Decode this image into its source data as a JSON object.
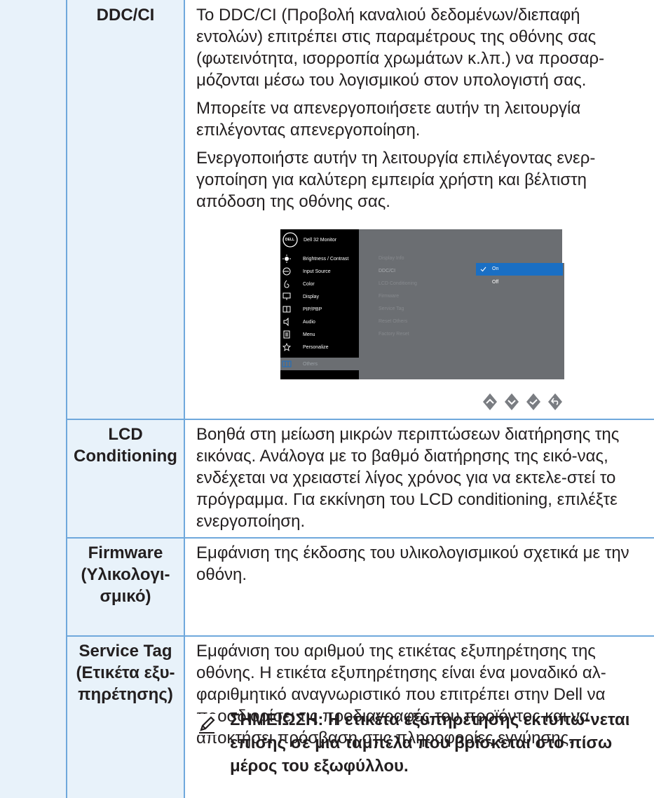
{
  "rows": [
    {
      "label": "DDC/CI",
      "paragraphs": [
        "Το DDC/CI (Προβολή καναλιού δεδομένων/διεπαφή εντολών) επιτρέπει στις παραμέτρους της οθόνης σας (φωτεινότητα, ισορροπία χρωμάτων κ.λπ.) να προσαρ-μόζονται μέσω του λογισμικού στον υπολογιστή σας.",
        "Μπορείτε να απενεργοποιήσετε αυτήν τη λειτουργία επιλέγοντας απενεργοποίηση.",
        "Ενεργοποιήστε αυτήν τη λειτουργία επιλέγοντας ενερ-γοποίηση για καλύτερη εμπειρία χρήστη και βέλτιστη απόδοση της οθόνης σας."
      ]
    },
    {
      "label_line1": "LCD",
      "label_line2": "Conditioning",
      "text": "Βοηθά στη μείωση μικρών περιπτώσεων διατήρησης της εικόνας. Ανάλογα με το βαθμό διατήρησης της εικό-νας, ενδέχεται να χρειαστεί λίγος χρόνος για να εκτελε-στεί το πρόγραμμα. Για εκκίνηση του LCD conditioning, επιλέξτε ενεργοποίηση."
    },
    {
      "label_line1": "Firmware",
      "label_line2": "(Υλικολογι-",
      "label_line3": "σμικό)",
      "text": "Εμφάνιση της έκδοσης του υλικολογισμικού σχετικά με την οθόνη."
    },
    {
      "label_line1": "Service Tag",
      "label_line2": "(Ετικέτα εξυ-",
      "label_line3": "πηρέτησης)",
      "text": "Εμφάνιση του αριθμού της ετικέτας εξυπηρέτησης της οθόνης. Η ετικέτα εξυπηρέτησης είναι ένα μοναδικό αλ-φαριθμητικό αναγνωριστικό που επιτρέπει στην Dell να προσδιορίσει τις προδιαγραφές του προϊόντος και να αποκτήσει πρόσβαση στις πληροφορίες εγγύησης.",
      "note": "ΣΗΜΕΙΩΣΗ: Η ετικέτα εξυπηρέτησης εκτυπώ-νεται επίσης σε μια ταμπέλα που βρίσκεται στο πίσω μέρος του εξωφύλλου."
    }
  ],
  "osd": {
    "logo": "DELL",
    "title": "Dell 32 Monitor",
    "menu": [
      "Brightness / Contrast",
      "Input Source",
      "Color",
      "Display",
      "PIP/PBP",
      "Audio",
      "Menu",
      "Personalize",
      "Others"
    ],
    "submenu": [
      "Display Info",
      "DDC/CI",
      "LCD Conditioning",
      "Firmware",
      "Service Tag",
      "Reset Others",
      "Factory Reset"
    ],
    "options": [
      "On",
      "Off"
    ],
    "selected_option": "On",
    "colors": {
      "panel": "#6b6e72",
      "sidebar": "#000000",
      "highlight": "#1a6fc4"
    }
  }
}
